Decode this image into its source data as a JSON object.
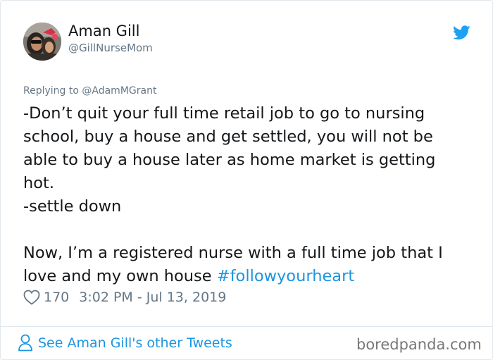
{
  "author": {
    "display_name": "Aman Gill",
    "handle": "@GillNurseMom"
  },
  "icons": {
    "logo": "twitter-bird-icon",
    "like": "heart-icon",
    "profile": "person-icon"
  },
  "reply_context": "Replying to @AdamMGrant",
  "tweet": {
    "lines": [
      "-Don’t quit your full time retail job to go to nursing",
      "school, buy a house and get settled, you will not be",
      "able to buy a house later as home market is getting",
      "hot.",
      "-settle down",
      "",
      "Now, I’m a registered nurse with a full time job that I"
    ],
    "last_line_text": "love and my own house ",
    "hashtag": "#followyourheart"
  },
  "meta": {
    "likes": "170",
    "timestamp": "3:02 PM - Jul 13, 2019"
  },
  "footer": {
    "see_more": "See Aman Gill's other Tweets",
    "watermark": "boredpanda.com"
  },
  "colors": {
    "link": "#1b95e0",
    "muted": "#657786",
    "text": "#14171a",
    "border": "#e1e8ed"
  }
}
